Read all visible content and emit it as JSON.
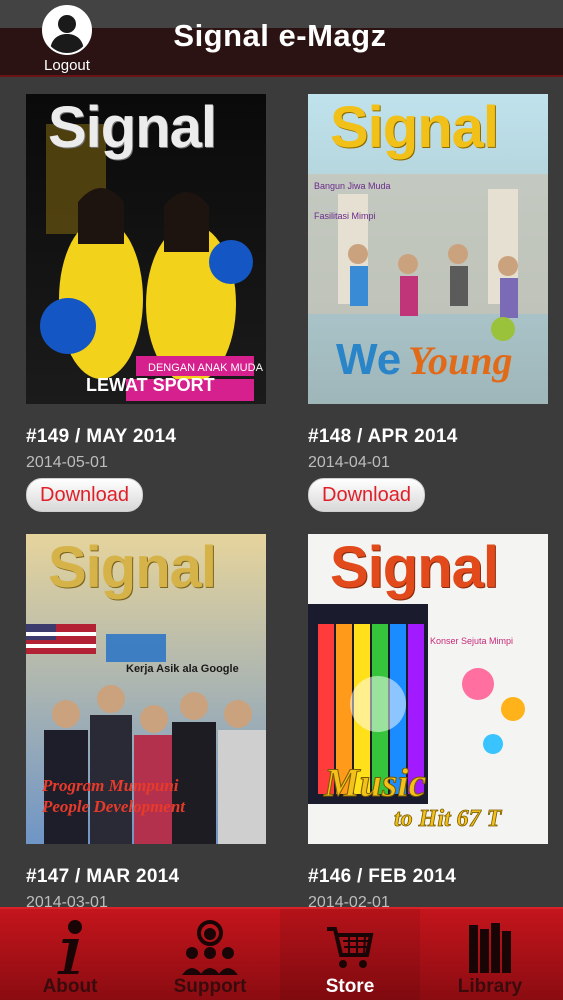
{
  "header": {
    "title": "Signal e-Magz",
    "logout_label": "Logout"
  },
  "issues": [
    {
      "issue": "#149 /  MAY 2014",
      "date": "2014-05-01",
      "download_label": "Download",
      "cover_masthead": "Signal",
      "cover_theme": "sport"
    },
    {
      "issue": "#148 / APR 2014",
      "date": "2014-04-01",
      "download_label": "Download",
      "cover_masthead": "Signal",
      "cover_theme": "we-young"
    },
    {
      "issue": "#147 / MAR 2014",
      "date": "2014-03-01",
      "cover_masthead": "Signal",
      "cover_theme": "google"
    },
    {
      "issue": "#146 /  FEB 2014",
      "date": "2014-02-01",
      "cover_masthead": "Signal",
      "cover_theme": "music"
    }
  ],
  "bottom_nav": [
    {
      "label": "About",
      "icon": "info-icon",
      "active": false
    },
    {
      "label": "Support",
      "icon": "support-icon",
      "active": false
    },
    {
      "label": "Store",
      "icon": "cart-icon",
      "active": true
    },
    {
      "label": "Library",
      "icon": "books-icon",
      "active": false
    }
  ],
  "colors": {
    "background": "#3b3b3b",
    "header": "#2b1314",
    "nav": "#c4151c",
    "download_text": "#e01f28"
  }
}
